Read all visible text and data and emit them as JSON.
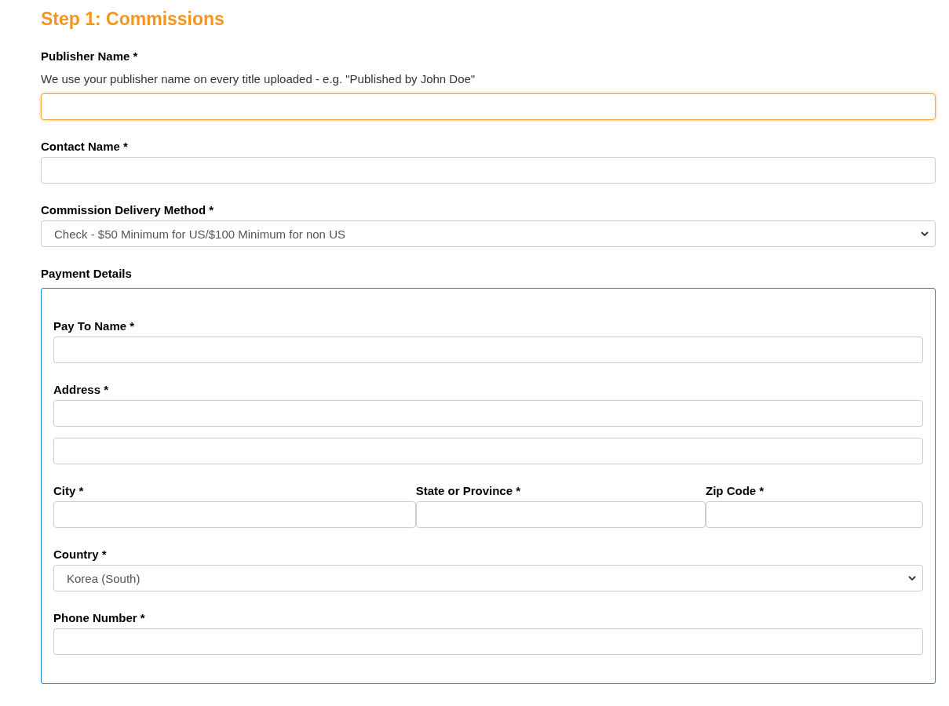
{
  "heading": "Step 1: Commissions",
  "fields": [
    {
      "kind": "text",
      "label": "Publisher Name *",
      "help": "We use your publisher name on every title uploaded - e.g. \"Published by John Doe\"",
      "focused": true
    },
    {
      "kind": "text",
      "label": "Contact Name *",
      "focused": false
    },
    {
      "kind": "select",
      "label": "Commission Delivery Method *",
      "value": "Check - $50 Minimum for US/$100 Minimum for non US"
    }
  ],
  "payment": {
    "title": "Payment Details",
    "rows": [
      [
        {
          "kind": "text",
          "label": "Pay To Name *",
          "focused": false
        }
      ],
      [
        {
          "kind": "text",
          "label": "Address *",
          "focused": false
        }
      ],
      [
        {
          "kind": "text",
          "focused": false
        }
      ],
      [
        {
          "kind": "text",
          "label": "City *",
          "focused": false
        },
        {
          "kind": "text",
          "label": "State or Province *",
          "focused": false
        },
        {
          "kind": "text",
          "label": "Zip Code *",
          "focused": false
        }
      ],
      [
        {
          "kind": "select",
          "label": "Country *",
          "value": "Korea (South)"
        }
      ],
      [
        {
          "kind": "text",
          "label": "Phone Number *",
          "focused": false
        }
      ]
    ]
  }
}
